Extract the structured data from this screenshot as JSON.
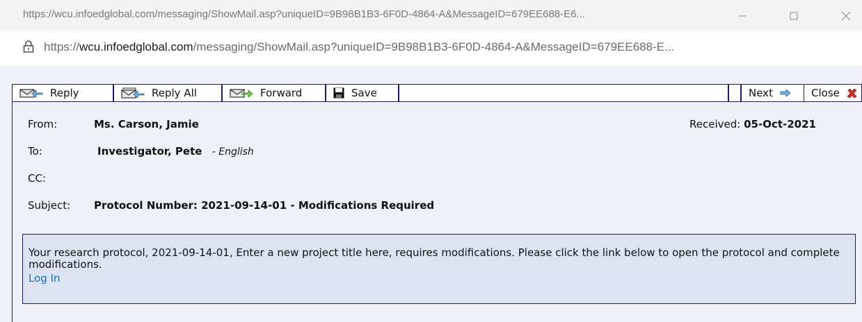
{
  "window": {
    "title": "https://wcu.infoedglobal.com/messaging/ShowMail.asp?uniqueID=9B98B1B3-6F0D-4864-A&MessageID=679EE688-E6..."
  },
  "address_bar": {
    "prefix": "https://",
    "host": "wcu.infoedglobal.com",
    "path": "/messaging/ShowMail.asp?uniqueID=9B98B1B3-6F0D-4864-A&MessageID=679EE688-E..."
  },
  "toolbar": {
    "reply_label": "Reply",
    "reply_all_label": "Reply All",
    "forward_label": "Forward",
    "save_label": "Save",
    "next_label": "Next",
    "close_label": "Close"
  },
  "message": {
    "from_label": "From:",
    "from_value": "Ms. Carson, Jamie",
    "received_label": "Received:",
    "received_value": "05-Oct-2021",
    "to_label": "To:",
    "to_value": "Investigator, Pete",
    "to_language": "- English",
    "cc_label": "CC:",
    "subject_label": "Subject:",
    "subject_value": "Protocol Number: 2021-09-14-01 - Modifications Required",
    "body": "Your research protocol, 2021-09-14-01, Enter a new project title here, requires modifications. Please click the link below to open the protocol and complete modifications.",
    "link_label": "Log In"
  },
  "icons": {
    "reply": "envelope-reply-icon",
    "reply_all": "envelope-reply-all-icon",
    "forward": "envelope-forward-icon",
    "save": "floppy-disk-icon",
    "next": "arrow-right-icon",
    "close": "red-x-icon",
    "lock": "lock-icon"
  },
  "colors": {
    "toolbar_border": "#1b1b7a",
    "panel_bg": "#eef2f8",
    "message_box_bg": "#dce4f2",
    "link": "#1a6fc4",
    "close_icon": "#d0302a"
  }
}
